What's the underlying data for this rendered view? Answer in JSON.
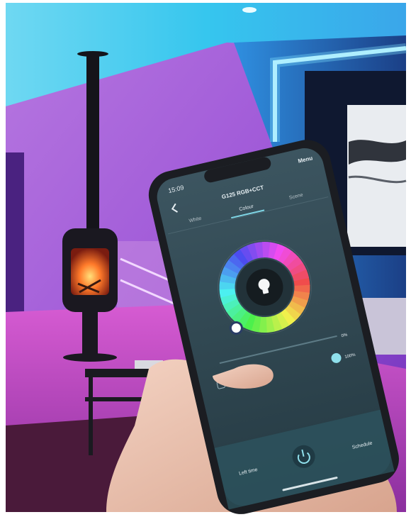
{
  "photo": {
    "subject": "living-room-rgb-lighting-with-smartphone-app",
    "colors": {
      "ceiling_cyan": "#35c8ee",
      "wall_blue": "#3a9fe8",
      "room_purple": "#a24fd8",
      "room_magenta": "#e25ad8",
      "fire_orange": "#ff7a2a",
      "phone_frame": "#1b1d22",
      "screen_teal": "#2e4650"
    }
  },
  "phone": {
    "status_time": "15:09",
    "device_title": "G125 RGB+CCT",
    "menu_label": "Menu",
    "back_icon": "chevron-left-icon",
    "tabs": [
      {
        "label": "White",
        "active": false
      },
      {
        "label": "Colour",
        "active": true
      },
      {
        "label": "Scene",
        "active": false
      }
    ],
    "color_wheel_icon": "lightbulb-icon",
    "saturation": {
      "label": "0%",
      "value": 0
    },
    "brightness": {
      "label": "100%",
      "value": 100
    },
    "bottom_bar": {
      "left_label": "Left time",
      "power_icon": "power-icon",
      "right_label": "Schedule"
    }
  }
}
